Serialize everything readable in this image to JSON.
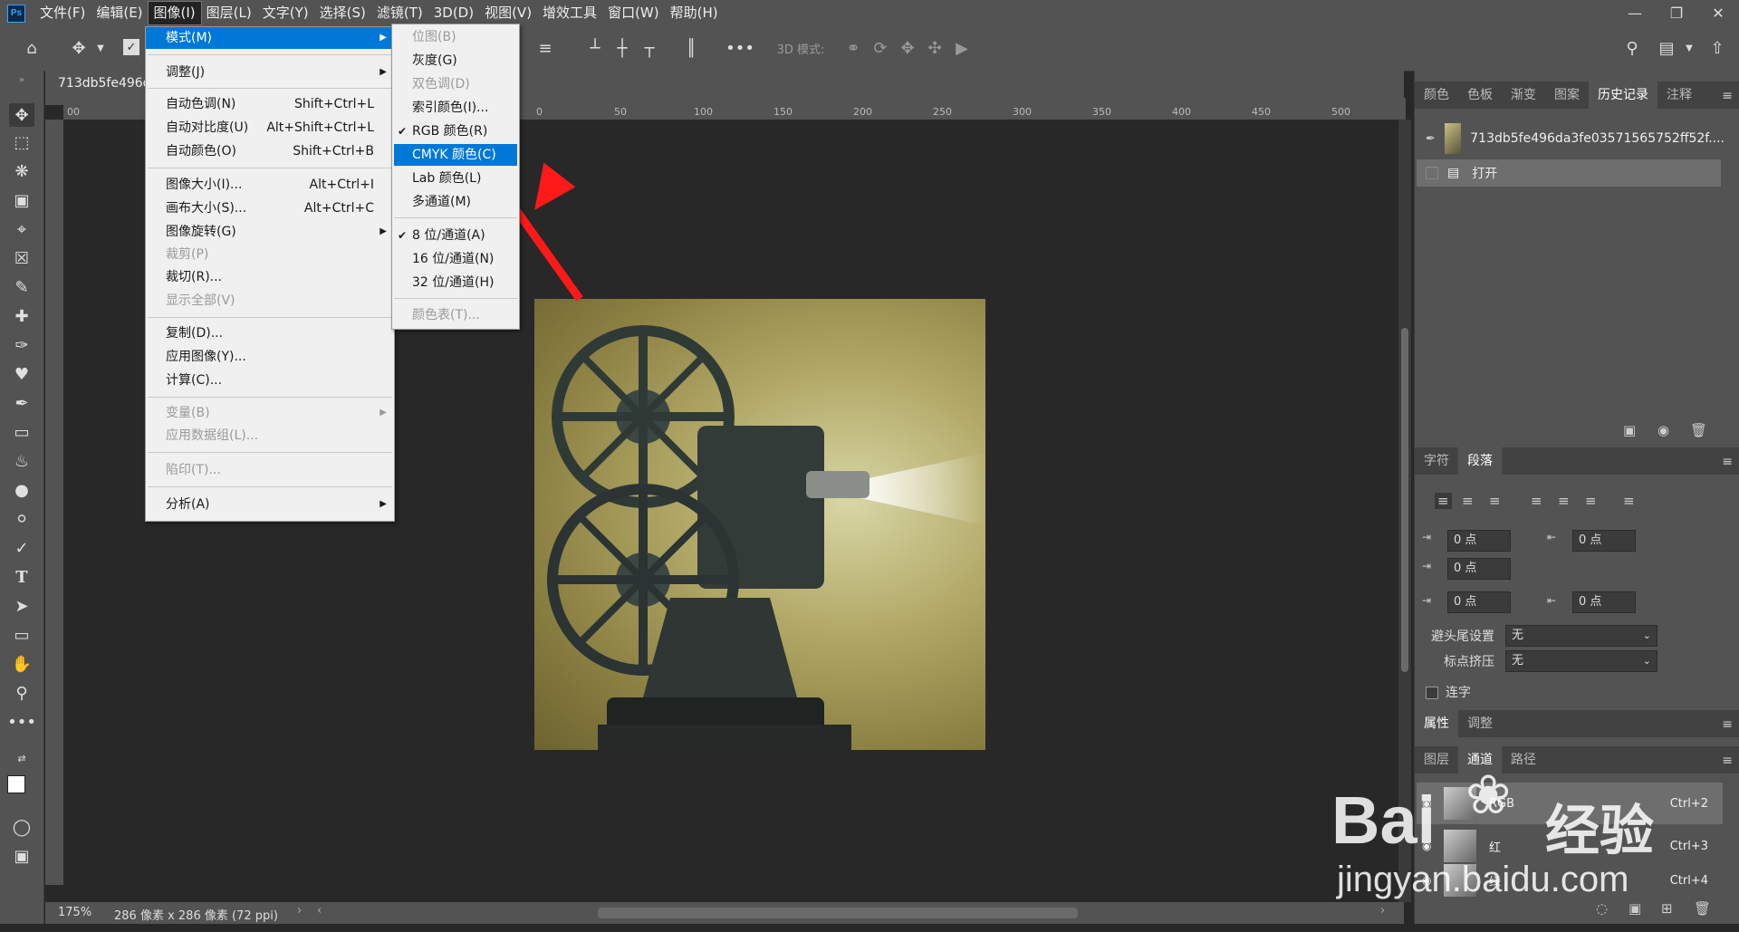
{
  "menubar": {
    "app_logo": "Ps",
    "items": [
      "文件(F)",
      "编辑(E)",
      "图像(I)",
      "图层(L)",
      "文字(Y)",
      "选择(S)",
      "滤镜(T)",
      "3D(D)",
      "视图(V)",
      "增效工具",
      "窗口(W)",
      "帮助(H)"
    ],
    "active_item": "图像(I)"
  },
  "optionsbar": {
    "label_3d": "3D 模式:"
  },
  "document": {
    "tab_title": "713db5fe496d",
    "ruler_ticks": [
      "00",
      "0",
      "50",
      "100",
      "150",
      "200",
      "250",
      "300",
      "350",
      "400",
      "450",
      "500"
    ],
    "zoom": "175%",
    "doc_info": "286 像素 x 286 像素 (72 ppi)"
  },
  "image_menu": {
    "items": [
      {
        "label": "模式(M)",
        "shortcut": "",
        "submenu": true,
        "highlighted": true,
        "disabled": false
      },
      {
        "label": "调整(J)",
        "shortcut": "",
        "submenu": true,
        "disabled": false
      },
      {
        "label": "自动色调(N)",
        "shortcut": "Shift+Ctrl+L",
        "disabled": false
      },
      {
        "label": "自动对比度(U)",
        "shortcut": "Alt+Shift+Ctrl+L",
        "disabled": false
      },
      {
        "label": "自动颜色(O)",
        "shortcut": "Shift+Ctrl+B",
        "disabled": false
      },
      {
        "label": "图像大小(I)...",
        "shortcut": "Alt+Ctrl+I",
        "disabled": false
      },
      {
        "label": "画布大小(S)...",
        "shortcut": "Alt+Ctrl+C",
        "disabled": false
      },
      {
        "label": "图像旋转(G)",
        "shortcut": "",
        "submenu": true,
        "disabled": false
      },
      {
        "label": "裁剪(P)",
        "shortcut": "",
        "disabled": true
      },
      {
        "label": "裁切(R)...",
        "shortcut": "",
        "disabled": false
      },
      {
        "label": "显示全部(V)",
        "shortcut": "",
        "disabled": true
      },
      {
        "label": "复制(D)...",
        "shortcut": "",
        "disabled": false
      },
      {
        "label": "应用图像(Y)...",
        "shortcut": "",
        "disabled": false
      },
      {
        "label": "计算(C)...",
        "shortcut": "",
        "disabled": false
      },
      {
        "label": "变量(B)",
        "shortcut": "",
        "submenu": true,
        "disabled": true
      },
      {
        "label": "应用数据组(L)...",
        "shortcut": "",
        "disabled": true
      },
      {
        "label": "陷印(T)...",
        "shortcut": "",
        "disabled": true
      },
      {
        "label": "分析(A)",
        "shortcut": "",
        "submenu": true,
        "disabled": false
      }
    ]
  },
  "mode_submenu": {
    "items": [
      {
        "label": "位图(B)",
        "disabled": true,
        "checked": false
      },
      {
        "label": "灰度(G)",
        "disabled": false,
        "checked": false
      },
      {
        "label": "双色调(D)",
        "disabled": true,
        "checked": false
      },
      {
        "label": "索引颜色(I)...",
        "disabled": false,
        "checked": false
      },
      {
        "label": "RGB 颜色(R)",
        "disabled": false,
        "checked": true
      },
      {
        "label": "CMYK 颜色(C)",
        "disabled": false,
        "checked": false,
        "highlighted": true
      },
      {
        "label": "Lab 颜色(L)",
        "disabled": false,
        "checked": false
      },
      {
        "label": "多通道(M)",
        "disabled": false,
        "checked": false
      },
      {
        "label": "8 位/通道(A)",
        "disabled": false,
        "checked": true
      },
      {
        "label": "16 位/通道(N)",
        "disabled": false,
        "checked": false
      },
      {
        "label": "32 位/通道(H)",
        "disabled": false,
        "checked": false
      },
      {
        "label": "颜色表(T)...",
        "disabled": true,
        "checked": false
      }
    ]
  },
  "history_panel": {
    "tabs": [
      "颜色",
      "色板",
      "渐变",
      "图案",
      "历史记录",
      "注释"
    ],
    "active_tab": "历史记录",
    "snapshot_name": "713db5fe496da3fe03571565752ff52f....",
    "states": [
      "打开"
    ]
  },
  "paragraph_panel": {
    "tabs": [
      "字符",
      "段落"
    ],
    "active_tab": "段落",
    "indent_left": "0 点",
    "indent_right": "0 点",
    "indent_first": "0 点",
    "space_before": "0 点",
    "space_after": "0 点",
    "kinsoku_label": "避头尾设置",
    "kinsoku_value": "无",
    "mojikumi_label": "标点挤压",
    "mojikumi_value": "无",
    "hyphenate_label": "连字"
  },
  "properties_panel": {
    "tabs": [
      "属性",
      "调整"
    ],
    "active_tab": "属性"
  },
  "channels_panel": {
    "tabs": [
      "图层",
      "通道",
      "路径"
    ],
    "active_tab": "通道",
    "channels": [
      {
        "name": "RGB",
        "shortcut": "Ctrl+2"
      },
      {
        "name": "红",
        "shortcut": "Ctrl+3"
      },
      {
        "name": "绿",
        "shortcut": "Ctrl+4"
      }
    ]
  },
  "watermark": {
    "brand": "Bai",
    "brand_cn": "经验",
    "url": "jingyan.baidu.com"
  },
  "colors": {
    "ui_bg": "#535353",
    "canvas_bg": "#282828",
    "menu_highlight": "#0078d7",
    "arrow": "#ff1a1a"
  }
}
